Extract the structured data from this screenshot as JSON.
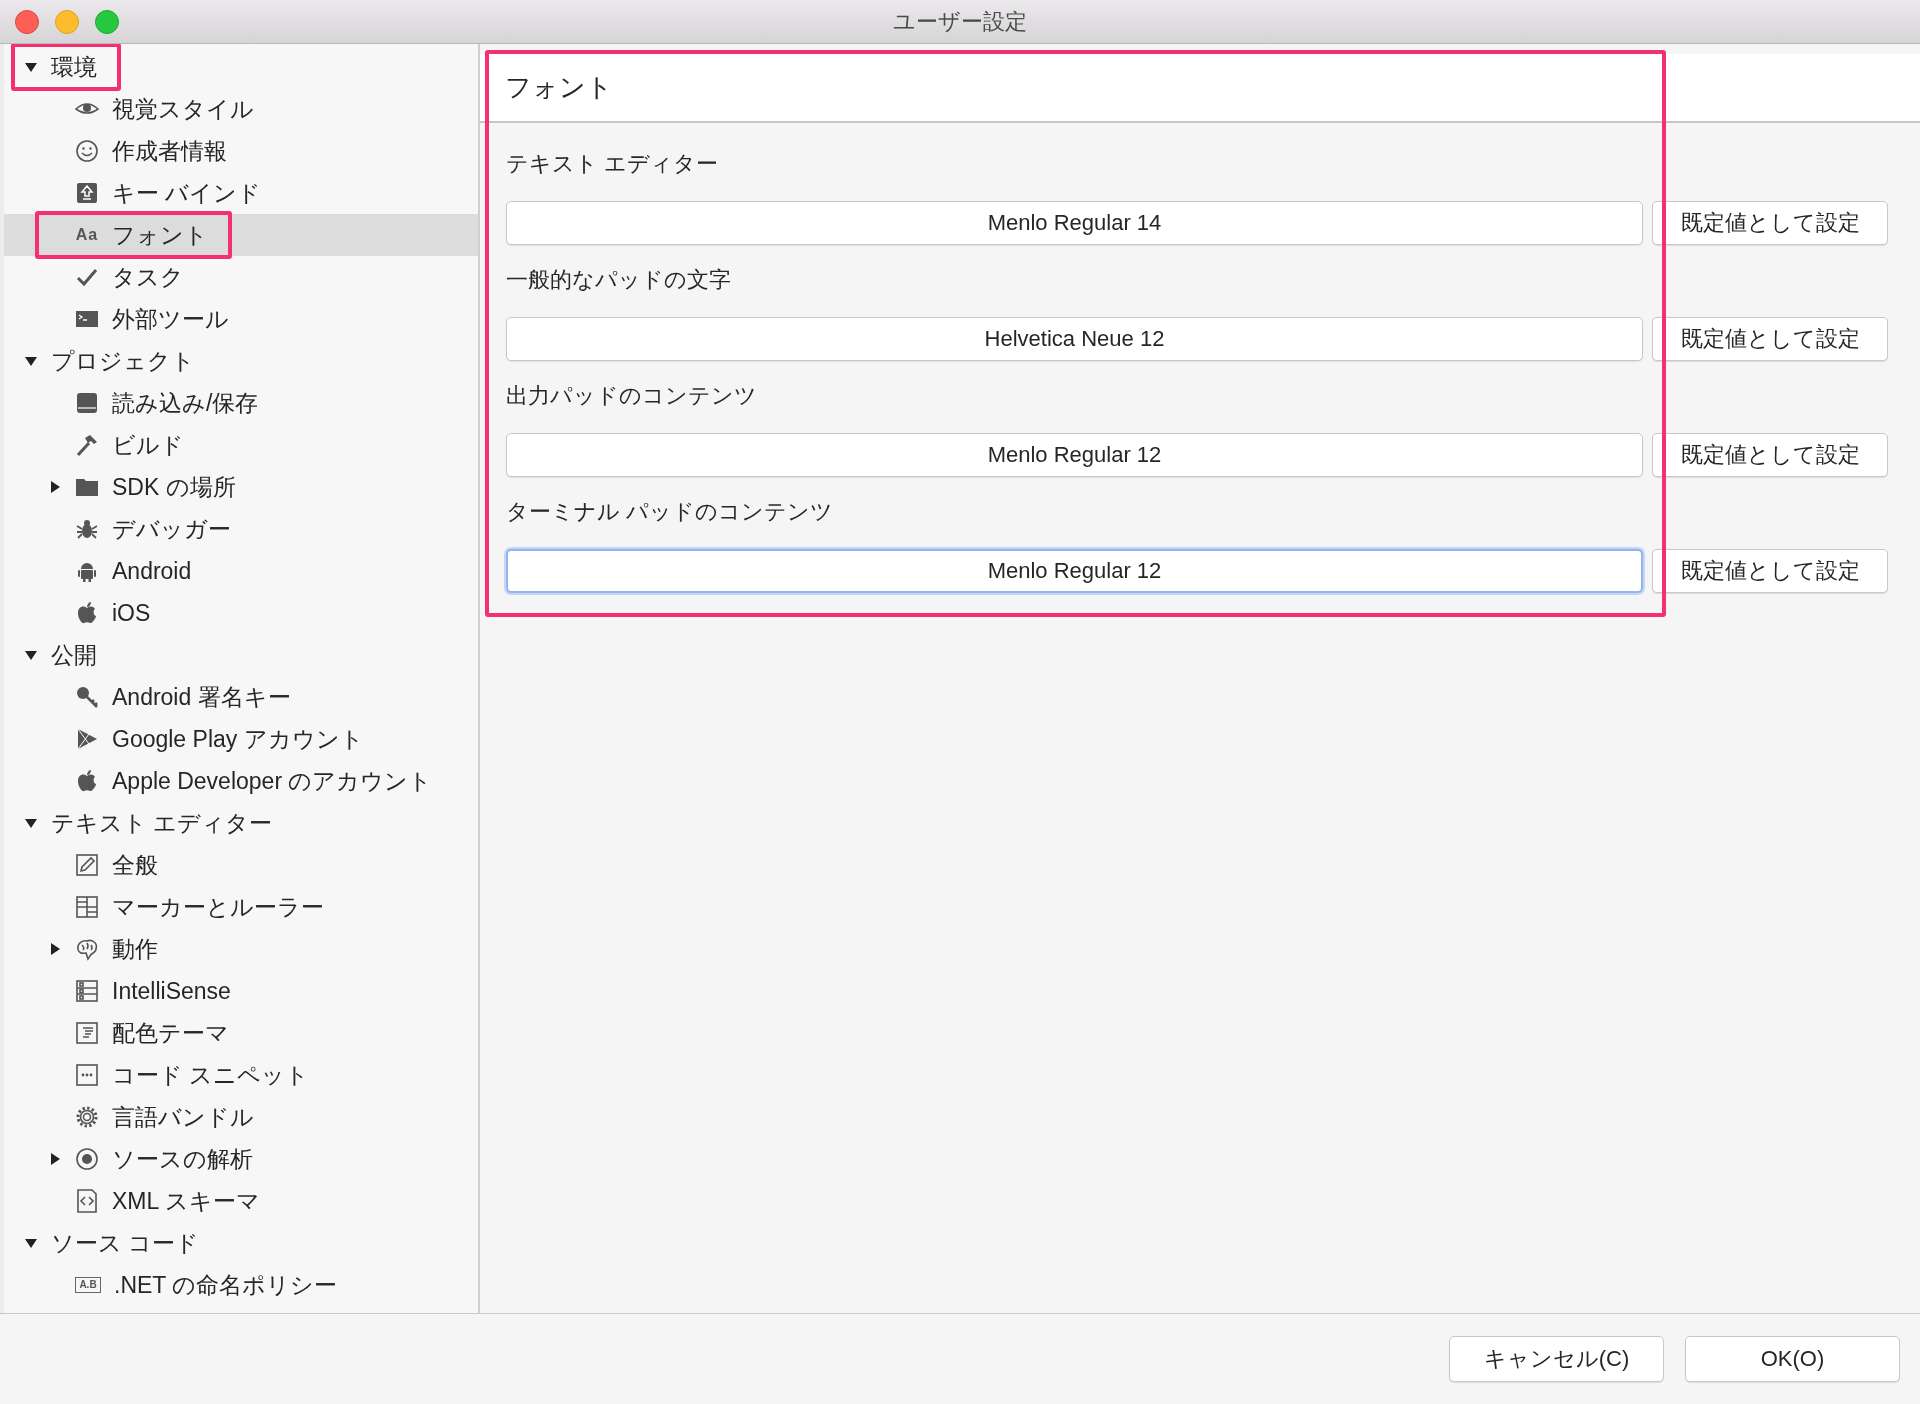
{
  "window": {
    "title": "ユーザー設定"
  },
  "sidebar": {
    "items": [
      {
        "label": "環境",
        "expanded": true,
        "selected": false,
        "highlighted": true,
        "children": [
          {
            "label": "視覚スタイル",
            "selected": false,
            "highlighted": false
          },
          {
            "label": "作成者情報",
            "selected": false,
            "highlighted": false
          },
          {
            "label": "キー バインド",
            "selected": false,
            "highlighted": false
          },
          {
            "label": "フォント",
            "icon_text": "Aa",
            "selected": true,
            "highlighted": true
          },
          {
            "label": "タスク",
            "selected": false,
            "highlighted": false
          },
          {
            "label": "外部ツール",
            "selected": false,
            "highlighted": false
          }
        ]
      },
      {
        "label": "プロジェクト",
        "expanded": true,
        "selected": false,
        "highlighted": false,
        "children": [
          {
            "label": "読み込み/保存",
            "selected": false,
            "highlighted": false
          },
          {
            "label": "ビルド",
            "selected": false,
            "highlighted": false
          },
          {
            "label": "SDK の場所",
            "expanded": false,
            "selected": false,
            "highlighted": false
          },
          {
            "label": "デバッガー",
            "selected": false,
            "highlighted": false
          },
          {
            "label": "Android",
            "selected": false,
            "highlighted": false
          },
          {
            "label": "iOS",
            "selected": false,
            "highlighted": false
          }
        ]
      },
      {
        "label": "公開",
        "expanded": true,
        "selected": false,
        "highlighted": false,
        "children": [
          {
            "label": "Android 署名キー",
            "selected": false,
            "highlighted": false
          },
          {
            "label": "Google Play アカウント",
            "selected": false,
            "highlighted": false
          },
          {
            "label": "Apple Developer のアカウント",
            "selected": false,
            "highlighted": false
          }
        ]
      },
      {
        "label": "テキスト エディター",
        "expanded": true,
        "selected": false,
        "highlighted": false,
        "children": [
          {
            "label": "全般",
            "selected": false,
            "highlighted": false
          },
          {
            "label": "マーカーとルーラー",
            "selected": false,
            "highlighted": false
          },
          {
            "label": "動作",
            "expanded": false,
            "selected": false,
            "highlighted": false
          },
          {
            "label": "IntelliSense",
            "selected": false,
            "highlighted": false
          },
          {
            "label": "配色テーマ",
            "selected": false,
            "highlighted": false
          },
          {
            "label": "コード スニペット",
            "selected": false,
            "highlighted": false
          },
          {
            "label": "言語バンドル",
            "selected": false,
            "highlighted": false
          },
          {
            "label": "ソースの解析",
            "expanded": false,
            "selected": false,
            "highlighted": false
          },
          {
            "label": "XML スキーマ",
            "selected": false,
            "highlighted": false
          }
        ]
      },
      {
        "label": "ソース コード",
        "expanded": true,
        "selected": false,
        "highlighted": false,
        "children": [
          {
            "label": ".NET の命名ポリシー",
            "icon_text": "A.B",
            "selected": false,
            "highlighted": false
          }
        ]
      }
    ]
  },
  "panel": {
    "title": "フォント",
    "highlighted": true,
    "settings": [
      {
        "label": "テキスト エディター",
        "value": "Menlo Regular 14",
        "focused": false,
        "button": "既定値として設定"
      },
      {
        "label": "一般的なパッドの文字",
        "value": "Helvetica Neue 12",
        "focused": false,
        "button": "既定値として設定"
      },
      {
        "label": "出力パッドのコンテンツ",
        "value": "Menlo Regular 12",
        "focused": false,
        "button": "既定値として設定"
      },
      {
        "label": "ターミナル パッドのコンテンツ",
        "value": "Menlo Regular 12",
        "focused": true,
        "button": "既定値として設定"
      }
    ]
  },
  "footer": {
    "buttons": [
      "キャンセル(C)",
      "OK(O)"
    ]
  }
}
